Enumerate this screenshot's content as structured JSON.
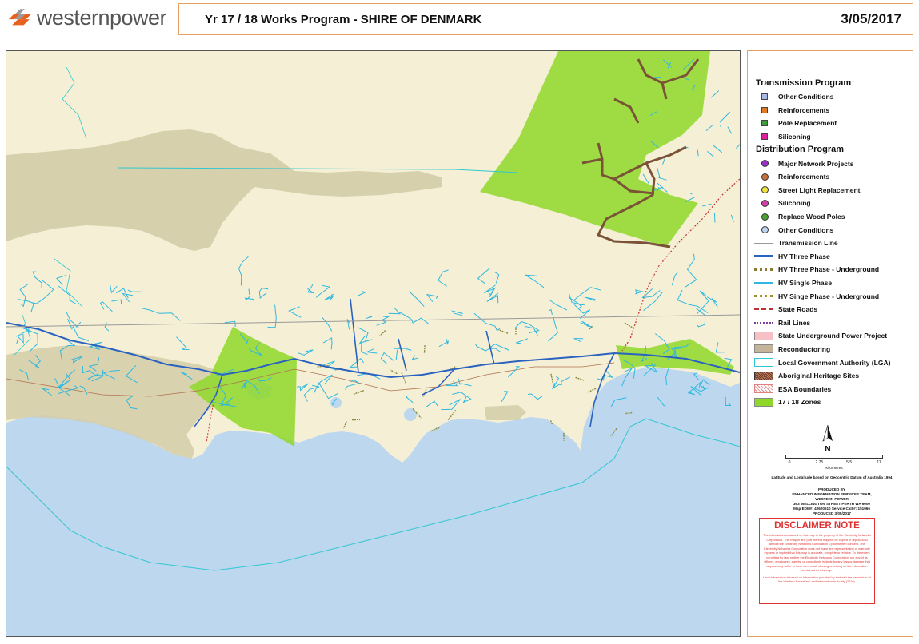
{
  "header": {
    "brand": "westernpower",
    "title": "Yr 17 / 18 Works Program - SHIRE OF DENMARK",
    "date": "3/05/2017"
  },
  "legend": {
    "transmission_title": "Transmission Program",
    "transmission": [
      {
        "label": "Other Conditions",
        "color": "#a8b8e8"
      },
      {
        "label": "Reinforcements",
        "color": "#e07a22"
      },
      {
        "label": "Pole Replacement",
        "color": "#3c9c3c"
      },
      {
        "label": "Siliconing",
        "color": "#e020a0"
      }
    ],
    "distribution_title": "Distribution Program",
    "distribution": [
      {
        "label": "Major Network Projects",
        "color": "#9b30c8"
      },
      {
        "label": "Reinforcements",
        "color": "#c8703c"
      },
      {
        "label": "Street Light Replacement",
        "color": "#f0e040"
      },
      {
        "label": "Siliconing",
        "color": "#d040a8"
      },
      {
        "label": "Replace Wood Poles",
        "color": "#4aa030"
      },
      {
        "label": "Other Conditions",
        "color": "#c0d4f0"
      }
    ],
    "lines": [
      {
        "label": "Transmission Line",
        "color": "#999999"
      },
      {
        "label": "HV Three Phase",
        "color": "#2a62c0"
      },
      {
        "label": "HV Three Phase - Underground",
        "color": "#8a7a30"
      },
      {
        "label": "HV Single Phase",
        "color": "#30b8e0"
      },
      {
        "label": "HV Singe Phase - Underground",
        "color": "#a09030"
      },
      {
        "label": "State Roads",
        "color": "#c03030"
      },
      {
        "label": "Rail Lines",
        "color": "#7a40a0"
      }
    ],
    "areas": [
      {
        "label": "State Underground Power Project",
        "color": "#f7c0c4"
      },
      {
        "label": "Reconductoring",
        "color": "#c4b49a"
      },
      {
        "label": "Local Government Authority (LGA)",
        "color": "#30c8d0"
      },
      {
        "label": "Aboriginal Heritage Sites",
        "color": "#6a3a2a"
      },
      {
        "label": "ESA Boundaries",
        "color": "#e08080"
      },
      {
        "label": "17 / 18 Zones",
        "color": "#8fd82a"
      }
    ]
  },
  "north_label": "N",
  "scale": {
    "ticks": [
      "0",
      "2.75",
      "5.5",
      "11"
    ],
    "unit": "Kilometres"
  },
  "datum_text": "Latitude and Longitude based on Geocentric Datum of Australia 1994",
  "produced_by": [
    "PRODUCED BY",
    "ENHANCED INFORMATION SERVICES TEAM,",
    "WESTERN POWER",
    "363 WELLINGTON STREET PERTH WA 6000",
    "Map EDM#: 42620510 Service Call #: 151066",
    "PRODUCED 3/05/2017"
  ],
  "disclaimer": {
    "title": "DISCLAIMER NOTE",
    "text1": "The information contained on this map is the property of the Electricity Networks Corporation. This map or any part thereof may not be copied or reproduced without the Electricity Networks Corporation's prior written consent. The Electricity Networks Corporation does not make any representation or warranty express or implied that this map is accurate, complete or reliable. To the extent permitted by law, neither the Electricity Networks Corporation, nor any of its officers, employees, agents, or consultants is liable for any loss or damage that anyone may suffer or incur as a result of using or relying on the information contained on this map.",
    "text2": "Land information is based on information provided by and with the permission of the Western Australian Land Information Authority (2016)."
  },
  "colors": {
    "sea": "#bdd7ef",
    "land": "#f5f0d5",
    "reconductoring": "#d4cca8",
    "zone": "#8fd82a",
    "hv_three": "#2a62c0",
    "hv_single": "#30b8e0",
    "lga": "#30c8d0",
    "state_road": "#c03030"
  }
}
